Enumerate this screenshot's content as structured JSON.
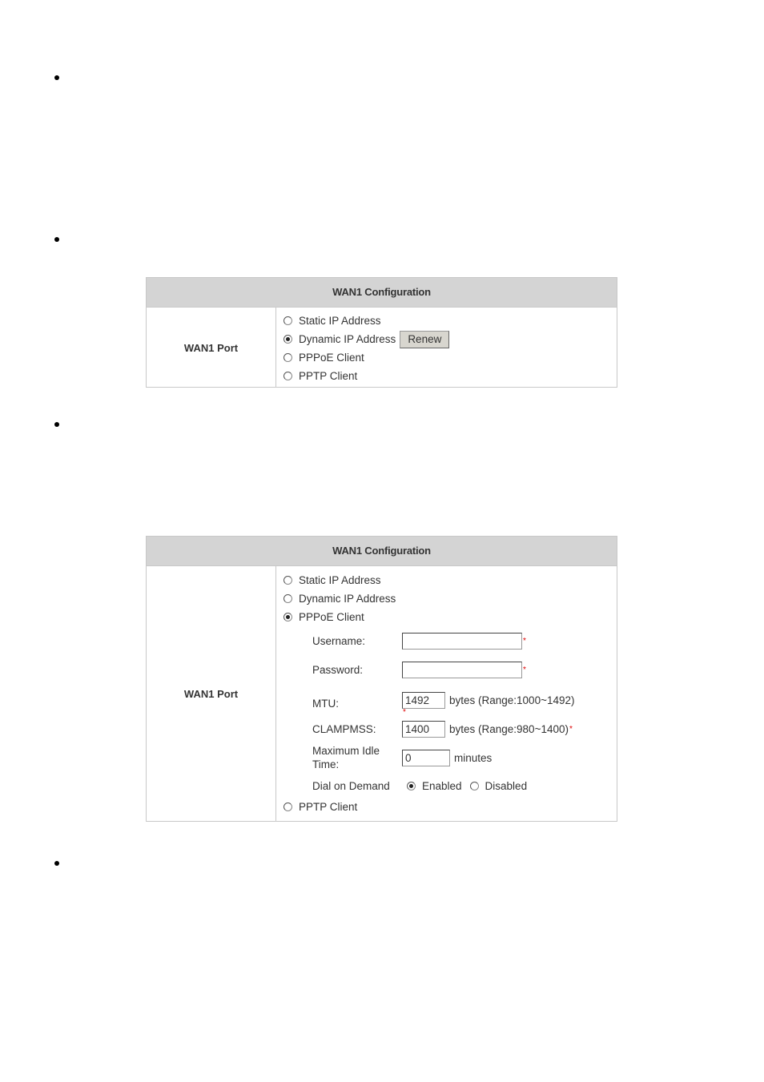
{
  "panels": [
    {
      "title": "WAN1 Configuration",
      "row_label": "WAN1 Port",
      "options": [
        {
          "label": "Static IP Address",
          "selected": false
        },
        {
          "label": "Dynamic IP Address",
          "selected": true
        },
        {
          "label": "PPPoE Client",
          "selected": false
        },
        {
          "label": "PPTP Client",
          "selected": false
        }
      ],
      "renew_label": "Renew"
    },
    {
      "title": "WAN1 Configuration",
      "row_label": "WAN1 Port",
      "options": [
        {
          "label": "Static IP Address",
          "selected": false
        },
        {
          "label": "Dynamic IP Address",
          "selected": false
        },
        {
          "label": "PPPoE Client",
          "selected": true
        },
        {
          "label": "PPTP Client",
          "selected": false
        }
      ],
      "pppoe": {
        "username": {
          "label": "Username:",
          "value": "",
          "required": "*"
        },
        "password": {
          "label": "Password:",
          "value": "",
          "required": "*"
        },
        "mtu": {
          "label": "MTU:",
          "value": "1492",
          "hint": "bytes (Range:1000~1492)",
          "required": "*"
        },
        "clampmss": {
          "label": "CLAMPMSS:",
          "value": "1400",
          "hint": "bytes (Range:980~1400)",
          "required": "*"
        },
        "idle": {
          "label": "Maximum Idle Time:",
          "value": "0",
          "hint": "minutes"
        },
        "dial": {
          "label": "Dial on Demand",
          "enabled_label": "Enabled",
          "disabled_label": "Disabled",
          "value": "Enabled"
        }
      }
    }
  ]
}
